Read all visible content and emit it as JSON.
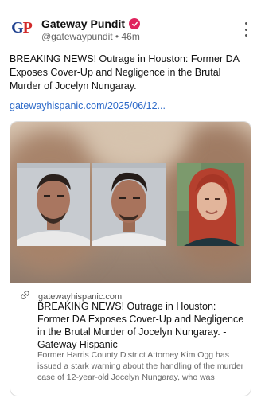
{
  "post": {
    "author_name": "Gateway Pundit",
    "logo_g": "G",
    "logo_p": "P",
    "handle": "@gatewaypundit",
    "separator": "•",
    "time": "46m",
    "more_icon": "more-vertical-icon",
    "verified_icon": "verified-badge-icon",
    "text": "BREAKING NEWS! Outrage in Houston: Former DA Exposes Cover-Up and Negligence in the Brutal Murder of Jocelyn Nungaray.",
    "link": "gatewayhispanic.com/2025/06/12..."
  },
  "card": {
    "link_icon": "link-icon",
    "domain": "gatewayhispanic.com",
    "title": "BREAKING NEWS! Outrage in Houston: Former DA Exposes Cover-Up and Negligence in the Brutal Murder of Jocelyn Nungaray. - Gateway Hispanic",
    "description": "Former Harris County District Attorney Kim Ogg has issued a stark warning about the handling of the murder case of 12-year-old Jocelyn Nungaray, who was"
  },
  "colors": {
    "link": "#2d6ac9",
    "verified": "#e0245e",
    "logo_blue": "#1d3f8f",
    "logo_red": "#d12a2a"
  }
}
